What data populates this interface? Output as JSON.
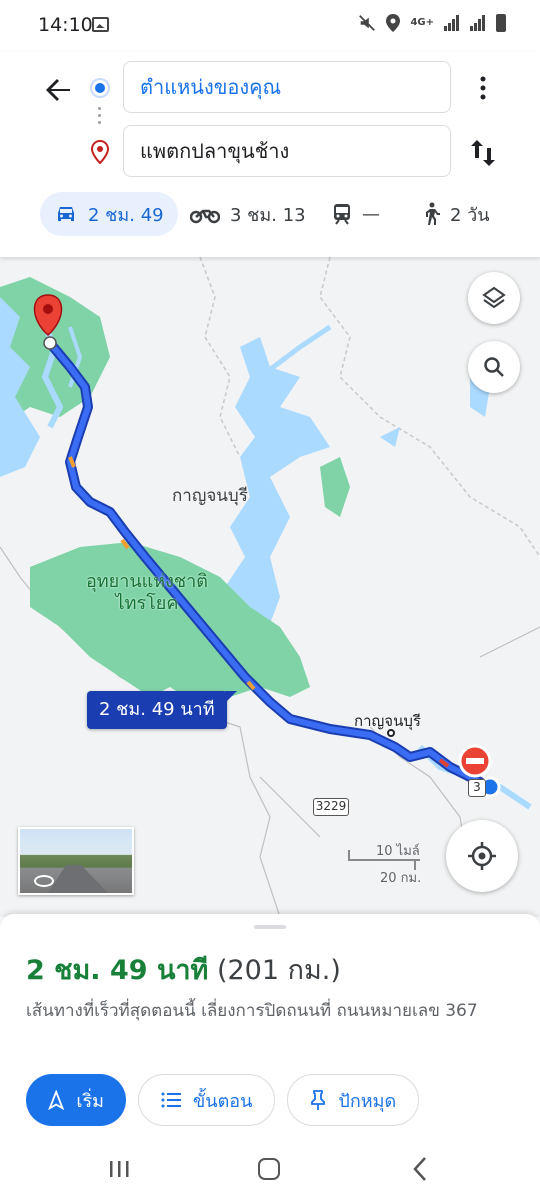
{
  "status_bar": {
    "time": "14:10",
    "network": "4G+"
  },
  "search": {
    "origin_value": "ตำแหน่งของคุณ",
    "destination_value": "แพตกปลาขุนช้าง"
  },
  "travel_modes": [
    {
      "mode": "drive",
      "icon": "car-icon",
      "label": "2 ชม. 49",
      "selected": true
    },
    {
      "mode": "motorbike",
      "icon": "motorcycle-icon",
      "label": "3 ชม. 13",
      "selected": false
    },
    {
      "mode": "transit",
      "icon": "train-icon",
      "label": "—",
      "selected": false
    },
    {
      "mode": "walk",
      "icon": "walk-icon",
      "label": "2 วัน",
      "selected": false
    }
  ],
  "map": {
    "labels": {
      "province": "กาญจนบุรี",
      "park": "อุทยานแห่งชาติ\nไทรโยค",
      "town": "กาญจนบุรี"
    },
    "route_time_callout": "2 ชม. 49 นาที",
    "road_shield": "3229",
    "road_shield_partial": "3",
    "scale": {
      "top": "10 ไมล์",
      "bottom": "20 กม."
    }
  },
  "route_summary": {
    "duration": "2 ชม. 49 นาที",
    "distance": "(201 กม.)",
    "description": "เส้นทางที่เร็วที่สุดตอนนี้ เลี่ยงการปิดถนนที่ ถนนหมายเลข 367"
  },
  "actions": {
    "start": "เริ่ม",
    "steps": "ขั้นตอน",
    "pin": "ปักหมุด"
  },
  "colors": {
    "accent": "#1a73e8",
    "route": "#2a56e0",
    "duration_green": "#188038",
    "park_green": "#7fd3a7",
    "water": "#aadaff"
  }
}
